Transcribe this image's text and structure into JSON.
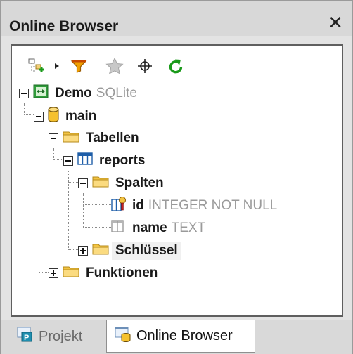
{
  "window": {
    "title": "Online Browser",
    "close_glyph": "✕"
  },
  "toolbar": {
    "icons": [
      "add-connection-icon",
      "dropdown-arrow-icon",
      "filter-icon",
      "favorites-icon",
      "locate-icon",
      "refresh-icon"
    ]
  },
  "tree": {
    "connection": {
      "name": "Demo",
      "type": "SQLite"
    },
    "schema": {
      "name": "main"
    },
    "tables_folder": {
      "name": "Tabellen"
    },
    "table": {
      "name": "reports"
    },
    "columns_folder": {
      "name": "Spalten"
    },
    "columns": [
      {
        "name": "id",
        "type": "INTEGER NOT NULL"
      },
      {
        "name": "name",
        "type": "TEXT"
      }
    ],
    "keys_folder": {
      "name": "Schlüssel"
    },
    "functions_folder": {
      "name": "Funktionen"
    }
  },
  "tabs": [
    {
      "label": "Projekt",
      "active": false
    },
    {
      "label": "Online Browser",
      "active": true
    }
  ],
  "colors": {
    "folder": "#f3c443",
    "refresh": "#1a9a1a",
    "filter": "#d98a00",
    "db": "#f5c12e"
  }
}
